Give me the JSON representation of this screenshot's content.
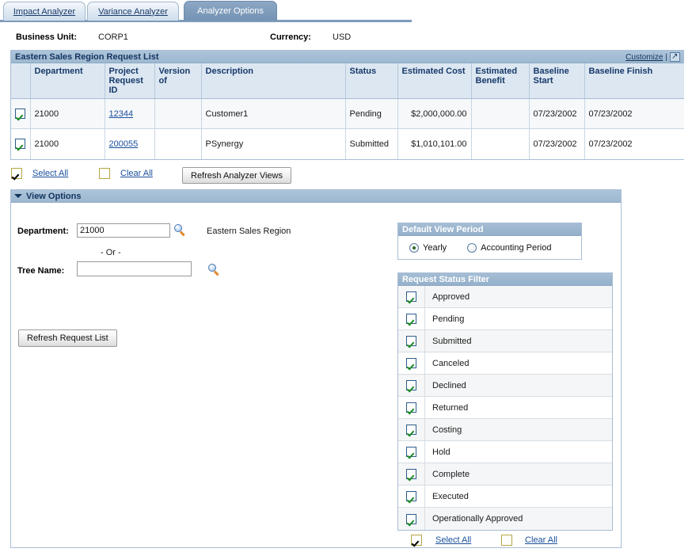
{
  "tabs": [
    {
      "label": "Impact Analyzer",
      "active": false
    },
    {
      "label": "Variance Analyzer",
      "active": false
    },
    {
      "label": "Analyzer Options",
      "active": true
    }
  ],
  "header": {
    "business_unit_label": "Business Unit:",
    "business_unit_value": "CORP1",
    "currency_label": "Currency:",
    "currency_value": "USD"
  },
  "grid": {
    "title": "Eastern Sales Region Request List",
    "customize_label": "Customize",
    "separator": "|",
    "popout_icon": "popout-window-icon",
    "columns": [
      "Department",
      "Project Request ID",
      "Version of",
      "Description",
      "Status",
      "Estimated Cost",
      "Estimated Benefit",
      "Baseline Start",
      "Baseline Finish"
    ],
    "rows": [
      {
        "selected": true,
        "department": "21000",
        "project_request_id": "12344",
        "version_of": "",
        "description": "Customer1",
        "status": "Pending",
        "estimated_cost": "$2,000,000.00",
        "estimated_benefit": "",
        "baseline_start": "07/23/2002",
        "baseline_finish": "07/23/2002"
      },
      {
        "selected": true,
        "department": "21000",
        "project_request_id": "200055",
        "version_of": "",
        "description": "PSynergy",
        "status": "Submitted",
        "estimated_cost": "$1,010,101.00",
        "estimated_benefit": "",
        "baseline_start": "07/23/2002",
        "baseline_finish": "07/23/2002"
      }
    ]
  },
  "grid_actions": {
    "select_all_label": "Select All",
    "select_all_checked": true,
    "clear_all_label": "Clear All",
    "clear_all_checked": false,
    "refresh_views_label": "Refresh Analyzer Views"
  },
  "view_options": {
    "title": "View Options",
    "department_label": "Department:",
    "department_value": "21000",
    "department_description": "Eastern Sales Region",
    "or_label": "- Or -",
    "tree_name_label": "Tree Name:",
    "tree_name_value": "",
    "tree_name_placeholder": "",
    "lookup_icon": "magnifier-icon",
    "refresh_request_list_label": "Refresh Request List",
    "default_view_period": {
      "title": "Default View Period",
      "options": [
        {
          "label": "Yearly",
          "selected": true
        },
        {
          "label": "Accounting Period",
          "selected": false
        }
      ]
    },
    "request_status_filter": {
      "title": "Request Status Filter",
      "items": [
        {
          "label": "Approved",
          "checked": true
        },
        {
          "label": "Pending",
          "checked": true
        },
        {
          "label": "Submitted",
          "checked": true
        },
        {
          "label": "Canceled",
          "checked": true
        },
        {
          "label": "Declined",
          "checked": true
        },
        {
          "label": "Returned",
          "checked": true
        },
        {
          "label": "Costing",
          "checked": true
        },
        {
          "label": "Hold",
          "checked": true
        },
        {
          "label": "Complete",
          "checked": true
        },
        {
          "label": "Executed",
          "checked": true
        },
        {
          "label": "Operationally Approved",
          "checked": true
        }
      ],
      "select_all_label": "Select All",
      "select_all_checked": true,
      "clear_all_label": "Clear All",
      "clear_all_checked": false
    }
  },
  "colors": {
    "tab_active_bg": "#7e9bba",
    "panel_header_bg": "#9db8d0",
    "grid_header_bg": "#dce7f1",
    "link": "#1a4f9c",
    "check_green": "#1e8b28"
  }
}
